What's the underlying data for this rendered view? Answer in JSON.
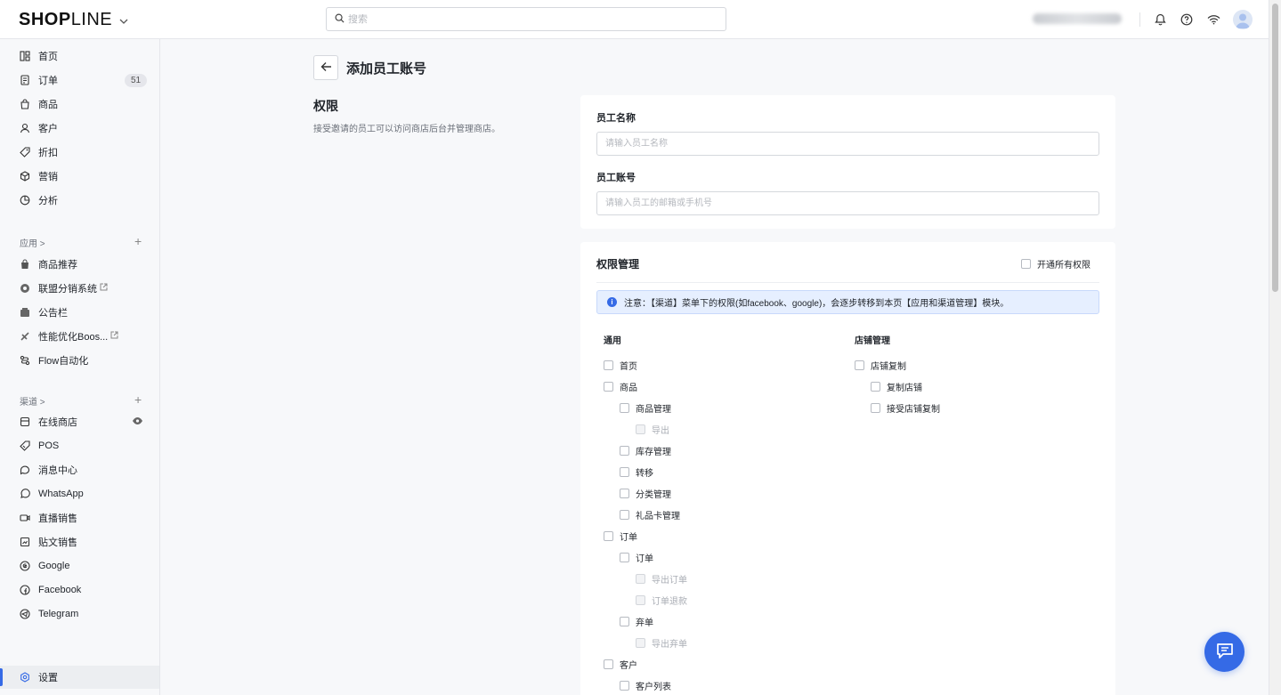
{
  "brand": {
    "logo_bold": "SHOP",
    "logo_light": "LINE",
    "chevron": "⌄"
  },
  "search": {
    "placeholder": "搜索"
  },
  "header": {
    "store_name": "████████"
  },
  "sidebar": {
    "main_items": [
      {
        "label": "首页",
        "icon": "home-icon"
      },
      {
        "label": "订单",
        "icon": "order-icon",
        "badge": "51"
      },
      {
        "label": "商品",
        "icon": "bag-icon"
      },
      {
        "label": "客户",
        "icon": "user-icon"
      },
      {
        "label": "折扣",
        "icon": "tag-icon"
      },
      {
        "label": "营销",
        "icon": "cube-icon"
      },
      {
        "label": "分析",
        "icon": "pie-icon"
      }
    ],
    "apps_label": "应用 >",
    "apps": [
      {
        "label": "商品推荐"
      },
      {
        "label": "联盟分销系统"
      },
      {
        "label": "公告栏"
      },
      {
        "label": "性能优化Boos..."
      },
      {
        "label": "Flow自动化"
      }
    ],
    "channels_label": "渠道 >",
    "channels": [
      {
        "label": "在线商店"
      },
      {
        "label": "POS"
      },
      {
        "label": "消息中心"
      },
      {
        "label": "WhatsApp"
      },
      {
        "label": "直播销售"
      },
      {
        "label": "贴文销售"
      },
      {
        "label": "Google"
      },
      {
        "label": "Facebook"
      },
      {
        "label": "Telegram"
      }
    ],
    "settings_label": "设置"
  },
  "page": {
    "title": "添加员工账号",
    "section_title": "权限",
    "section_desc": "接受邀请的员工可以访问商店后台并管理商店。"
  },
  "form": {
    "name_label": "员工名称",
    "name_placeholder": "请输入员工名称",
    "account_label": "员工账号",
    "account_placeholder": "请输入员工的邮箱或手机号"
  },
  "permissions": {
    "title": "权限管理",
    "enable_all": "开通所有权限",
    "notice": "注意：【渠道】菜单下的权限(如facebook、google)，会逐步转移到本页【应用和渠道管理】模块。",
    "general_title": "通用",
    "general": [
      {
        "label": "首页",
        "level": 0,
        "disabled": false
      },
      {
        "label": "商品",
        "level": 0,
        "disabled": false
      },
      {
        "label": "商品管理",
        "level": 1,
        "disabled": false
      },
      {
        "label": "导出",
        "level": 2,
        "disabled": true
      },
      {
        "label": "库存管理",
        "level": 1,
        "disabled": false
      },
      {
        "label": "转移",
        "level": 1,
        "disabled": false
      },
      {
        "label": "分类管理",
        "level": 1,
        "disabled": false
      },
      {
        "label": "礼品卡管理",
        "level": 1,
        "disabled": false
      },
      {
        "label": "订单",
        "level": 0,
        "disabled": false
      },
      {
        "label": "订单",
        "level": 1,
        "disabled": false
      },
      {
        "label": "导出订单",
        "level": 2,
        "disabled": true
      },
      {
        "label": "订单退款",
        "level": 2,
        "disabled": true
      },
      {
        "label": "弃单",
        "level": 1,
        "disabled": false
      },
      {
        "label": "导出弃单",
        "level": 2,
        "disabled": true
      },
      {
        "label": "客户",
        "level": 0,
        "disabled": false
      },
      {
        "label": "客户列表",
        "level": 1,
        "disabled": false
      }
    ],
    "store_title": "店铺管理",
    "store": [
      {
        "label": "店铺复制",
        "level": 0,
        "disabled": false
      },
      {
        "label": "复制店铺",
        "level": 1,
        "disabled": false
      },
      {
        "label": "接受店铺复制",
        "level": 1,
        "disabled": false
      }
    ]
  },
  "colors": {
    "accent": "#356ae6",
    "notice_bg": "#e6efff"
  }
}
